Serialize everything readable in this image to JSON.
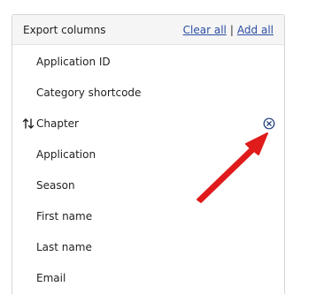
{
  "panel": {
    "title": "Export columns",
    "clear_all": "Clear all",
    "separator": "|",
    "add_all": "Add all"
  },
  "columns": [
    {
      "label": "Application ID",
      "hover": false
    },
    {
      "label": "Category shortcode",
      "hover": false
    },
    {
      "label": "Chapter",
      "hover": true
    },
    {
      "label": "Application",
      "hover": false
    },
    {
      "label": "Season",
      "hover": false
    },
    {
      "label": "First name",
      "hover": false
    },
    {
      "label": "Last name",
      "hover": false
    },
    {
      "label": "Email",
      "hover": false
    }
  ],
  "icons": {
    "drag": "drag-sort-icon",
    "remove": "close-circle-icon",
    "annotation": "red-arrow-annotation"
  },
  "colors": {
    "link": "#2c4ea3",
    "arrow": "#e01b1b",
    "remove_icon": "#1e3a7a"
  }
}
